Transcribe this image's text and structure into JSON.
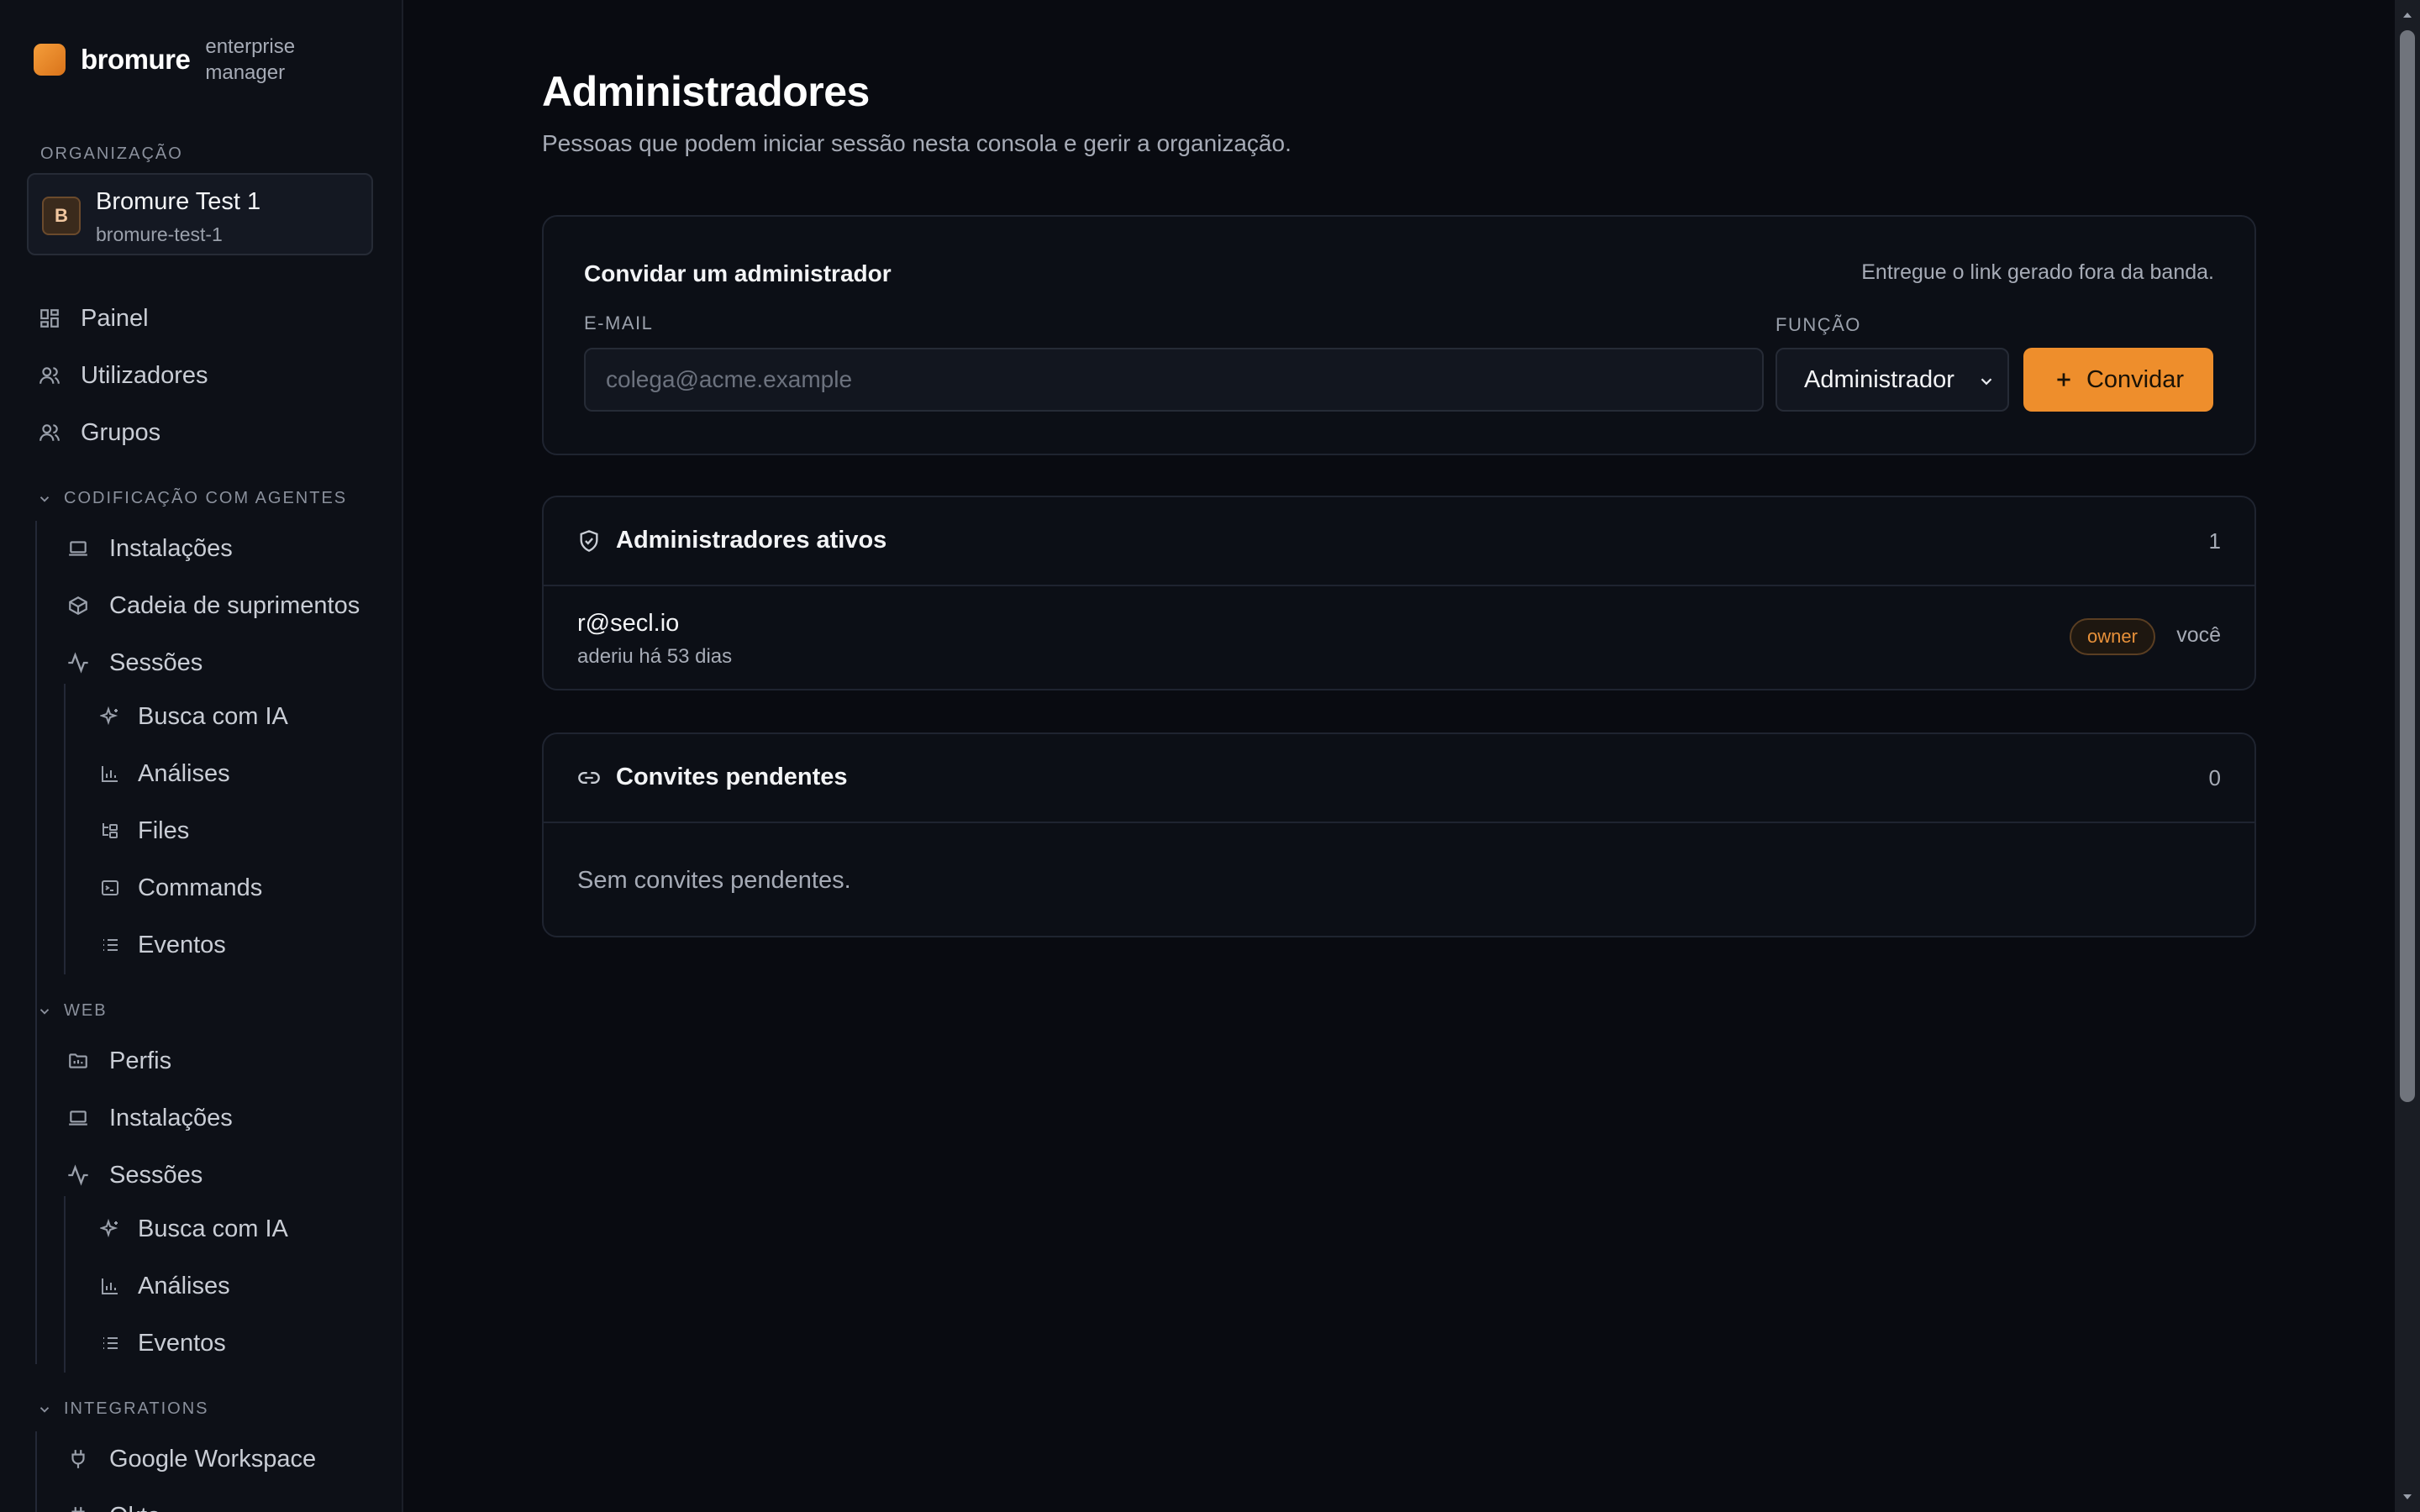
{
  "brand": {
    "name": "bromure",
    "subtitle": "enterprise manager"
  },
  "sidebar": {
    "org_label": "ORGANIZAÇÃO",
    "org": {
      "initial": "B",
      "name": "Bromure Test 1",
      "slug": "bromure-test-1"
    },
    "top_items": [
      {
        "label": "Painel",
        "icon": "dashboard-icon"
      },
      {
        "label": "Utilizadores",
        "icon": "users-icon"
      },
      {
        "label": "Grupos",
        "icon": "users-group-icon"
      }
    ],
    "groups": [
      {
        "label": "CODIFICAÇÃO COM AGENTES",
        "items": [
          {
            "label": "Instalações",
            "icon": "laptop-icon"
          },
          {
            "label": "Cadeia de suprimentos",
            "icon": "package-icon"
          },
          {
            "label": "Sessões",
            "icon": "activity-icon"
          }
        ],
        "sub_items": [
          {
            "label": "Busca com IA",
            "icon": "sparkles-icon"
          },
          {
            "label": "Análises",
            "icon": "bar-chart-icon"
          },
          {
            "label": "Files",
            "icon": "folder-tree-icon"
          },
          {
            "label": "Commands",
            "icon": "terminal-icon"
          },
          {
            "label": "Eventos",
            "icon": "list-icon"
          }
        ]
      },
      {
        "label": "WEB",
        "items": [
          {
            "label": "Perfis",
            "icon": "folder-icon"
          },
          {
            "label": "Instalações",
            "icon": "laptop-icon"
          },
          {
            "label": "Sessões",
            "icon": "activity-icon"
          }
        ],
        "sub_items": [
          {
            "label": "Busca com IA",
            "icon": "sparkles-icon"
          },
          {
            "label": "Análises",
            "icon": "bar-chart-icon"
          },
          {
            "label": "Eventos",
            "icon": "list-icon"
          }
        ]
      },
      {
        "label": "INTEGRATIONS",
        "items": [
          {
            "label": "Google Workspace",
            "icon": "plug-icon"
          },
          {
            "label": "Okta",
            "icon": "plug-icon"
          }
        ]
      }
    ]
  },
  "page": {
    "title": "Administradores",
    "subtitle": "Pessoas que podem iniciar sessão nesta consola e gerir a organização."
  },
  "invite": {
    "title": "Convidar um administrador",
    "hint": "Entregue o link gerado fora da banda.",
    "email_label": "E-MAIL",
    "email_placeholder": "colega@acme.example",
    "email_value": "",
    "role_label": "FUNÇÃO",
    "role_value": "Administrador",
    "button_label": "Convidar"
  },
  "active_admins": {
    "title": "Administradores ativos",
    "count": "1",
    "rows": [
      {
        "email": "r@secl.io",
        "joined": "aderiu há 53 dias",
        "badge": "owner",
        "note": "você"
      }
    ]
  },
  "pending_invites": {
    "title": "Convites pendentes",
    "count": "0",
    "empty_text": "Sem convites pendentes."
  },
  "colors": {
    "accent": "#ee8e2c",
    "background": "#090b11",
    "sidebar": "#0d1017"
  }
}
